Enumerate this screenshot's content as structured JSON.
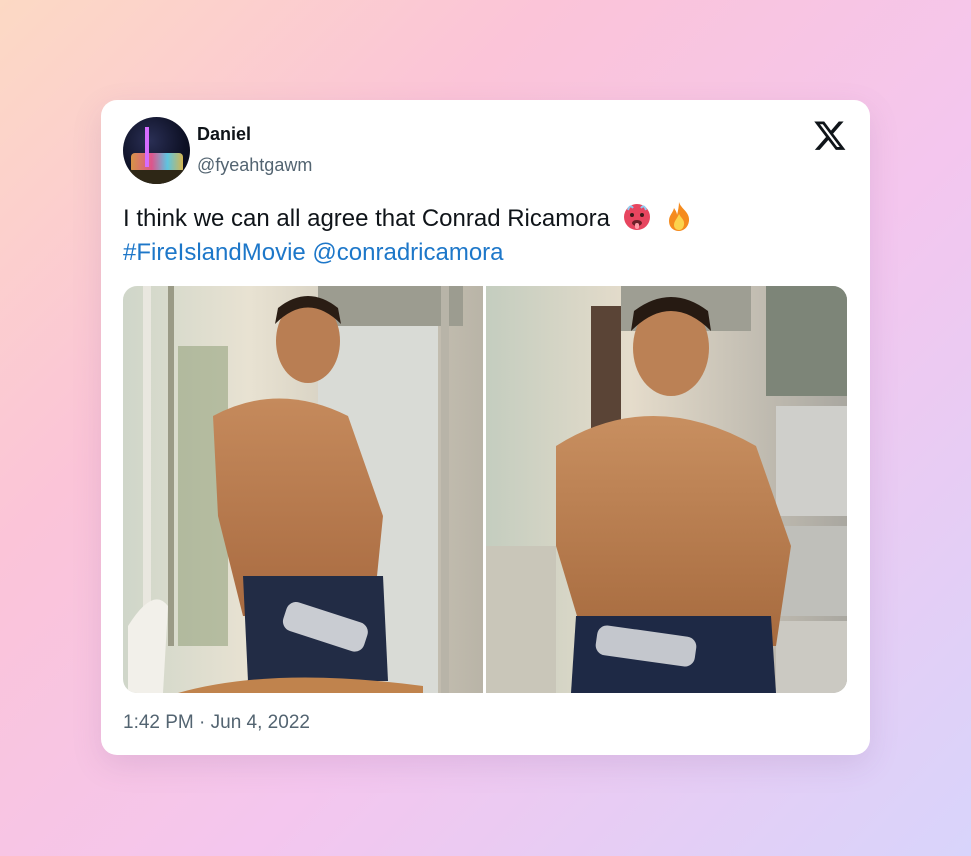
{
  "tweet": {
    "author_name": "Daniel",
    "author_handle": "@fyeahtgawm",
    "text_plain": "I think we can all agree that Conrad Ricamora",
    "hashtag": "#FireIslandMovie",
    "mention": "@conradricamora",
    "emojis": [
      "hot-face-emoji",
      "fire-emoji"
    ],
    "timestamp": "1:42 PM · Jun 4, 2022",
    "media": [
      {
        "icon": "photo-shirtless-man-kitchen-1"
      },
      {
        "icon": "photo-shirtless-man-kitchen-2"
      }
    ]
  },
  "colors": {
    "link": "#1d77c9",
    "text": "#0f1419",
    "muted": "#536471"
  }
}
